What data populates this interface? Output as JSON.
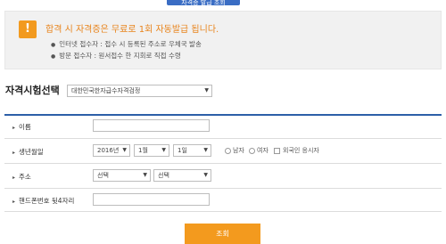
{
  "top_tab": {
    "label": "자격증 발급 조회"
  },
  "notice": {
    "icon": "exclamation-icon",
    "title": "합격 시 자격증은 무료로 1회 자동발급 됩니다.",
    "lines": [
      "인터넷 접수자 : 접수 시 등록된 주소로 우체국 발송",
      "방문 접수자 : 원서접수 한 지회로 직접 수령"
    ]
  },
  "exam_select": {
    "label": "자격시험선택",
    "value": "대한민국한자급수자격검정"
  },
  "form": {
    "name": {
      "label": "이름",
      "value": ""
    },
    "birth": {
      "label": "생년월일",
      "year": "2016년",
      "month": "1월",
      "day": "1일",
      "male": "남자",
      "female": "여자",
      "foreigner": "외국인 응시자"
    },
    "address": {
      "label": "주소",
      "select1": "선택",
      "select2": "선택"
    },
    "phone": {
      "label": "핸드폰번호 뒷4자리",
      "value": ""
    }
  },
  "submit": {
    "label": "조회"
  },
  "colors": {
    "accent": "#f39a1e",
    "rule": "#2d5fa8"
  }
}
